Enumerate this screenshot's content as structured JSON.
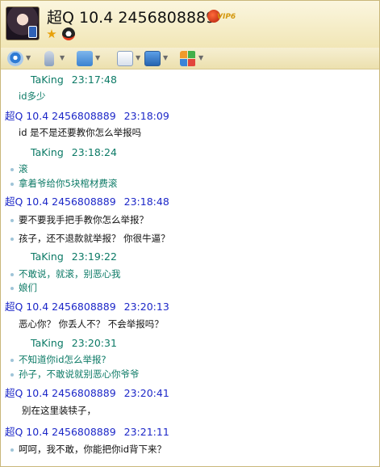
{
  "contact": {
    "name": "超Q 10.4 2456808889",
    "vip_label": "VIP6"
  },
  "toolbar": {
    "items": [
      "video-call-icon",
      "voice-call-icon",
      "send-file-icon",
      "message-manager-icon",
      "screen-share-icon",
      "apps-icon"
    ]
  },
  "messages": [
    {
      "sender": "TaKing",
      "time": "23:17:48",
      "side": "self",
      "lines": [
        "id多少"
      ]
    },
    {
      "sender": "超Q 10.4 2456808889",
      "time": "23:18:09",
      "side": "other",
      "lines": [
        "id 是不是还要教你怎么举报吗"
      ]
    },
    {
      "sender": "TaKing",
      "time": "23:18:24",
      "side": "self",
      "lines": [
        "滚",
        "拿着爷给你5块棺材费滚"
      ]
    },
    {
      "sender": "超Q 10.4 2456808889",
      "time": "23:18:48",
      "side": "other",
      "lines": [
        "要不要我手把手教你怎么举报？",
        "孩子，还不退款就举报？ 你很牛逼？"
      ]
    },
    {
      "sender": "TaKing",
      "time": "23:19:22",
      "side": "self",
      "lines": [
        "不敢说，就滚，别恶心我",
        "娘们"
      ]
    },
    {
      "sender": "超Q 10.4 2456808889",
      "time": "23:20:13",
      "side": "other",
      "lines": [
        "恶心你？ 你丢人不？ 不会举报吗？"
      ]
    },
    {
      "sender": "TaKing",
      "time": "23:20:31",
      "side": "self",
      "lines": [
        "不知道你id怎么举报?",
        "孙子，不敢说就别恶心你爷爷"
      ]
    },
    {
      "sender": "超Q 10.4 2456808889",
      "time": "23:20:41",
      "side": "other",
      "lines": [
        "别在这里装犊子，"
      ]
    },
    {
      "sender": "超Q 10.4 2456808889",
      "time": "23:21:11",
      "side": "other",
      "lines": [
        "呵呵，我不敢，你能把你id背下来？"
      ]
    }
  ]
}
